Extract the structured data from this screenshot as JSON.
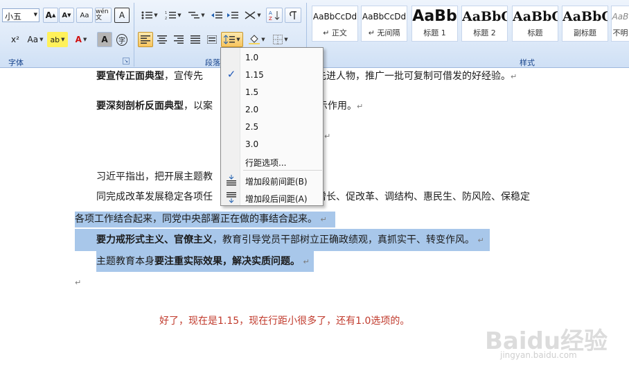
{
  "ribbon": {
    "font_group": {
      "font_size": "小五",
      "label": "字体",
      "buttons": {
        "grow_font": "A",
        "shrink_font": "A",
        "clear_format": "Aa",
        "phonetic": "wén 文",
        "char_border": "A",
        "superscript": "x²",
        "change_case": "Aa",
        "highlight": "ab",
        "font_color": "A",
        "char_shading": "A",
        "enclose": "字"
      }
    },
    "paragraph_group": {
      "label": "段落"
    },
    "styles_group": {
      "label": "样式",
      "tiles": [
        {
          "sample": "AaBbCcDd",
          "name": "↵ 正文"
        },
        {
          "sample": "AaBbCcDd",
          "name": "↵ 无间隔"
        },
        {
          "sample": "AaBb",
          "name": "标题 1"
        },
        {
          "sample": "AaBbC",
          "name": "标题 2"
        },
        {
          "sample": "AaBbC",
          "name": "标题"
        },
        {
          "sample": "AaBbC",
          "name": "副标题"
        },
        {
          "sample": "AaB",
          "name": "不明"
        }
      ]
    }
  },
  "line_spacing_menu": {
    "options": [
      "1.0",
      "1.15",
      "1.5",
      "2.0",
      "2.5",
      "3.0"
    ],
    "selected": "1.15",
    "check_glyph": "✓",
    "line_spacing_options": "行距选项...",
    "add_space_before": "增加段前间距(B)",
    "add_space_after": "增加段后间距(A)"
  },
  "document": {
    "line1_bold": "要宣传正面典型",
    "line1_rest": "，宣传先",
    "line1_tail": "的先进人物，推广一批可复制可借发的好经验。",
    "line2_bold": "要深刻剖析反面典型",
    "line2_rest": "，以案",
    "line2_tail": "发挥警示作用。",
    "line3": "习近平指出，把开展主题教",
    "line4_a": "同完成改革发展稳定各项任",
    "line4_b": "稳增长、促改革、调结构、惠民生、防风险、保稳定",
    "line5": "各项工作结合起来，同党中央部署正在做的事结合起来。",
    "line6_bold": "要力戒形式主义、官僚主义",
    "line6_rest": "，教育引导党员干部树立正确政绩观，真抓实干、转变作风。",
    "line7_a": "主题教育本身",
    "line7_bold": "要注重实际效果，解决实质问题。",
    "para_mark": "↵"
  },
  "caption": "好了，现在是1.15，现在行距小很多了，还有1.0选项的。",
  "watermark": {
    "main": "Baidu经验",
    "sub": "jingyan.baidu.com"
  }
}
